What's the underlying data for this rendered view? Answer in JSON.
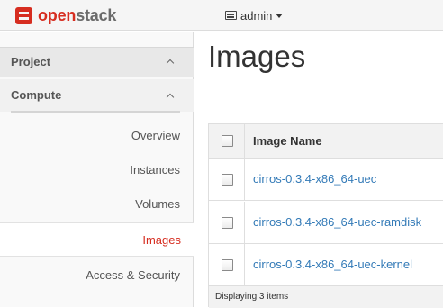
{
  "navbar": {
    "brand_open": "open",
    "brand_stack": "stack",
    "project_label": "admin"
  },
  "sidebar": {
    "project_label": "Project",
    "compute_label": "Compute",
    "items": [
      {
        "label": "Overview",
        "active": false
      },
      {
        "label": "Instances",
        "active": false
      },
      {
        "label": "Volumes",
        "active": false
      },
      {
        "label": "Images",
        "active": true
      },
      {
        "label": "Access & Security",
        "active": false
      }
    ]
  },
  "main": {
    "title": "Images",
    "table": {
      "column_header": "Image Name",
      "rows": [
        {
          "name": "cirros-0.3.4-x86_64-uec"
        },
        {
          "name": "cirros-0.3.4-x86_64-uec-ramdisk"
        },
        {
          "name": "cirros-0.3.4-x86_64-uec-kernel"
        }
      ],
      "footer": "Displaying 3 items"
    }
  },
  "colors": {
    "brand_red": "#d62d20",
    "link_blue": "#337ab7",
    "active_nav": "#d62d20"
  }
}
